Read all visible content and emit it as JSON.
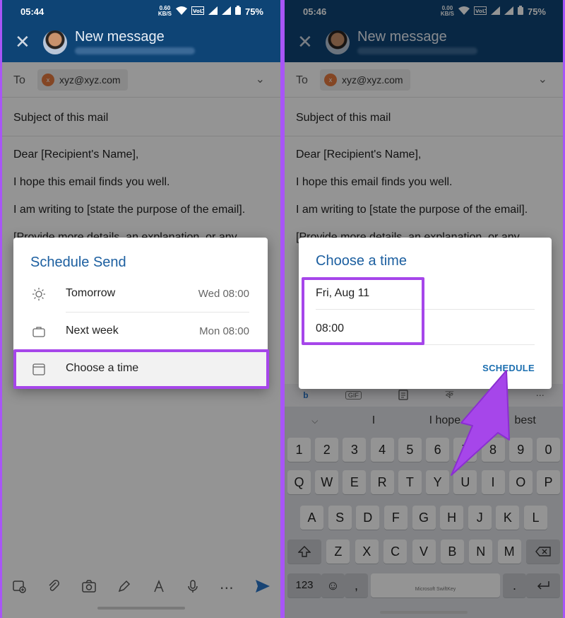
{
  "left": {
    "status": {
      "time": "05:44",
      "net": "0.60\nKB/S",
      "battery": "75%"
    },
    "header": {
      "title": "New message"
    },
    "to": {
      "label": "To",
      "chip_initial": "x",
      "email": "xyz@xyz.com"
    },
    "subject": "Subject of this mail",
    "body": [
      "Dear [Recipient's Name],",
      "I hope this email finds you well.",
      "I am writing to [state the purpose of the email].",
      "[Provide more details, an explanation, or any"
    ],
    "dialog": {
      "title": "Schedule Send",
      "options": [
        {
          "label": "Tomorrow",
          "value": "Wed 08:00",
          "icon": "sun-icon"
        },
        {
          "label": "Next week",
          "value": "Mon 08:00",
          "icon": "briefcase-icon"
        },
        {
          "label": "Choose a time",
          "value": "",
          "icon": "calendar-icon"
        }
      ]
    }
  },
  "right": {
    "status": {
      "time": "05:46",
      "net": "0.00\nKB/S",
      "battery": "75%"
    },
    "header": {
      "title": "New message"
    },
    "to": {
      "label": "To",
      "chip_initial": "x",
      "email": "xyz@xyz.com"
    },
    "subject": "Subject of this mail",
    "body": [
      "Dear [Recipient's Name],",
      "I hope this email finds you well.",
      "I am writing to [state the purpose of the email].",
      "[Provide more details, an explanation, or any"
    ],
    "dialog": {
      "title": "Choose a time",
      "date": "Fri, Aug 11",
      "time": "08:00",
      "action": "SCHEDULE"
    },
    "keyboard": {
      "tools": [
        "GIF",
        "ৰু"
      ],
      "suggestions": [
        "I",
        "I hope",
        "best"
      ],
      "row_numbers": [
        "1",
        "2",
        "3",
        "4",
        "5",
        "6",
        "7",
        "8",
        "9",
        "0"
      ],
      "row1": [
        "Q",
        "W",
        "E",
        "R",
        "T",
        "Y",
        "U",
        "I",
        "O",
        "P"
      ],
      "row2": [
        "A",
        "S",
        "D",
        "F",
        "G",
        "H",
        "J",
        "K",
        "L"
      ],
      "row3": [
        "Z",
        "X",
        "C",
        "V",
        "B",
        "N",
        "M"
      ],
      "bottom": {
        "mode": "123",
        "comma": ",",
        "space": "Microsoft SwiftKey",
        "period": "."
      }
    }
  },
  "colors": {
    "header": "#0e4475",
    "accent": "#1c5fa0",
    "highlight": "#a646ea"
  }
}
